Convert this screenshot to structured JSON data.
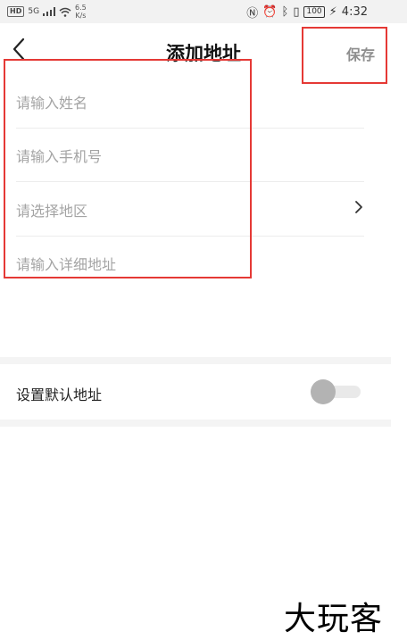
{
  "status_bar": {
    "hd": "HD",
    "signal": "5G",
    "speed_value": "6.5",
    "speed_unit": "K/s",
    "battery": "100",
    "time": "4:32"
  },
  "header": {
    "title": "添加地址",
    "save_label": "保存"
  },
  "form": {
    "name_placeholder": "请输入姓名",
    "phone_placeholder": "请输入手机号",
    "region_placeholder": "请选择地区",
    "detail_placeholder": "请输入详细地址"
  },
  "default_address": {
    "label": "设置默认地址",
    "enabled": false
  },
  "watermark": "大玩客",
  "colors": {
    "highlight": "#e53935",
    "placeholder": "#a4a4a4",
    "save_text": "#8e8e8e"
  }
}
